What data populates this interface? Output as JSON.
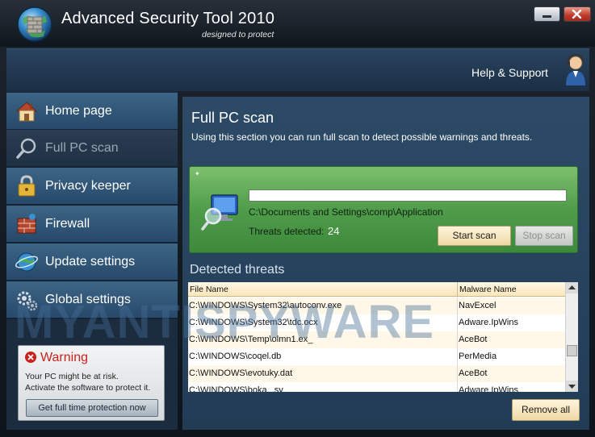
{
  "window": {
    "title": "Advanced Security Tool 2010",
    "tagline": "designed to protect",
    "watermark": "MYANTISPYWARE"
  },
  "header": {
    "help_label": "Help & Support"
  },
  "sidebar": {
    "items": [
      {
        "label": "Home page",
        "icon": "house-icon"
      },
      {
        "label": "Full PC scan",
        "icon": "magnifier-icon",
        "active": true
      },
      {
        "label": "Privacy keeper",
        "icon": "padlock-icon"
      },
      {
        "label": "Firewall",
        "icon": "brick-wall-icon"
      },
      {
        "label": "Update settings",
        "icon": "globe-icon"
      },
      {
        "label": "Global settings",
        "icon": "gears-icon"
      }
    ],
    "warning": {
      "title": "Warning",
      "line1": "Your PC might be at risk.",
      "line2": "Activate the software to protect it.",
      "button_label": "Get full time protection now"
    }
  },
  "main": {
    "title": "Full PC scan",
    "description": "Using this section you can run full scan to detect possible warnings and threats.",
    "scan": {
      "current_path": "C:\\Documents and Settings\\comp\\Application",
      "threats_label": "Threats detected:",
      "threats_count": "24",
      "progress_fraction": 0.0,
      "start_label": "Start scan",
      "stop_label": "Stop scan"
    },
    "threats_section_title": "Detected threats",
    "table": {
      "headers": [
        "File Name",
        "Malware Name"
      ],
      "rows": [
        [
          "C:\\WINDOWS\\System32\\autoconv.exe",
          "NavExcel"
        ],
        [
          "C:\\WINDOWS\\System32\\tdc.ocx",
          "Adware.IpWins"
        ],
        [
          "C:\\WINDOWS\\Temp\\olmn1.ex_",
          "AceBot"
        ],
        [
          "C:\\WINDOWS\\coqel.db",
          "PerMedia"
        ],
        [
          "C:\\WINDOWS\\evotuky.dat",
          "AceBot"
        ],
        [
          "C:\\WINDOWS\\boka...sy",
          "Adware.IpWins"
        ]
      ]
    },
    "remove_all_label": "Remove all"
  },
  "colors": {
    "scan_panel_green": "#4f9c4a",
    "warning_red": "#c8231c",
    "nav_blue": "#3d6586"
  }
}
